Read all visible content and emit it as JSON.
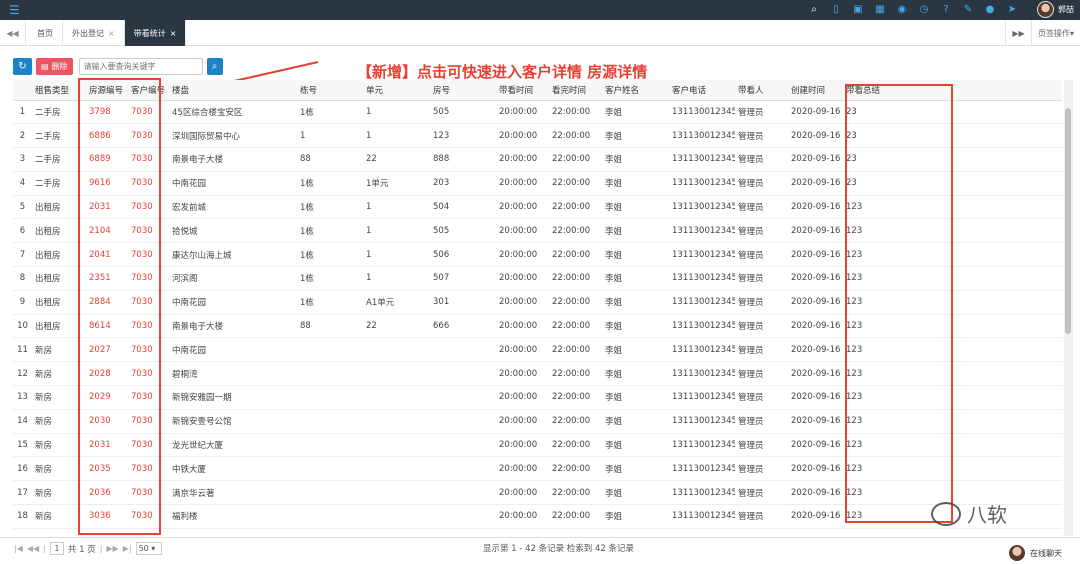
{
  "header": {
    "menu_icon": "menu-icon",
    "icons": [
      "search-icon",
      "phone-icon",
      "ad-icon",
      "grid-icon",
      "location-icon",
      "clock-icon",
      "help-icon",
      "edit-icon",
      "user-icon",
      "run-icon"
    ],
    "user_name": "郭喆"
  },
  "tabs": {
    "items": [
      {
        "label": "首页",
        "active": false
      },
      {
        "label": "外出登记",
        "active": false,
        "close": "×"
      },
      {
        "label": "带看统计",
        "active": true,
        "close": "×"
      }
    ],
    "page_ops": "页签操作",
    "page_ops_arrow": "▾",
    "nav_left": "◀◀",
    "nav_right": "▶▶"
  },
  "toolbar": {
    "delete_label": "删除",
    "search_placeholder": "请输入要查询关键字"
  },
  "annotation": "【新增】点击可快速进入客户详情 房源详情",
  "table": {
    "columns": [
      "",
      "租售类型",
      "房源编号",
      "客户编号",
      "楼盘",
      "栋号",
      "单元",
      "房号",
      "带看时间",
      "看完时间",
      "客户姓名",
      "客户电话",
      "带看人",
      "创建时间",
      "带看总结"
    ],
    "rows": [
      [
        "1",
        "二手房",
        "3798",
        "7030",
        "45区综合楼宝安区",
        "1栋",
        "1",
        "505",
        "20:00:00",
        "22:00:00",
        "李姐",
        "131130012345(",
        "管理员",
        "2020-09-16",
        "23"
      ],
      [
        "2",
        "二手房",
        "6886",
        "7030",
        "深圳国际贸易中心",
        "1",
        "1",
        "123",
        "20:00:00",
        "22:00:00",
        "李姐",
        "131130012345(",
        "管理员",
        "2020-09-16",
        "23"
      ],
      [
        "3",
        "二手房",
        "6889",
        "7030",
        "南景电子大楼",
        "88",
        "22",
        "888",
        "20:00:00",
        "22:00:00",
        "李姐",
        "131130012345(",
        "管理员",
        "2020-09-16",
        "23"
      ],
      [
        "4",
        "二手房",
        "9616",
        "7030",
        "中南花园",
        "1栋",
        "1单元",
        "203",
        "20:00:00",
        "22:00:00",
        "李姐",
        "131130012345(",
        "管理员",
        "2020-09-16",
        "23"
      ],
      [
        "5",
        "出租房",
        "2031",
        "7030",
        "宏发前城",
        "1栋",
        "1",
        "504",
        "20:00:00",
        "22:00:00",
        "李姐",
        "131130012345(",
        "管理员",
        "2020-09-16",
        "123"
      ],
      [
        "6",
        "出租房",
        "2104",
        "7030",
        "拾悦城",
        "1栋",
        "1",
        "505",
        "20:00:00",
        "22:00:00",
        "李姐",
        "131130012345(",
        "管理员",
        "2020-09-16",
        "123"
      ],
      [
        "7",
        "出租房",
        "2041",
        "7030",
        "康达尔山海上城",
        "1栋",
        "1",
        "506",
        "20:00:00",
        "22:00:00",
        "李姐",
        "131130012345(",
        "管理员",
        "2020-09-16",
        "123"
      ],
      [
        "8",
        "出租房",
        "2351",
        "7030",
        "河滨阁",
        "1栋",
        "1",
        "507",
        "20:00:00",
        "22:00:00",
        "李姐",
        "131130012345(",
        "管理员",
        "2020-09-16",
        "123"
      ],
      [
        "9",
        "出租房",
        "2884",
        "7030",
        "中南花园",
        "1栋",
        "A1单元",
        "301",
        "20:00:00",
        "22:00:00",
        "李姐",
        "131130012345(",
        "管理员",
        "2020-09-16",
        "123"
      ],
      [
        "10",
        "出租房",
        "8614",
        "7030",
        "南景电子大楼",
        "88",
        "22",
        "666",
        "20:00:00",
        "22:00:00",
        "李姐",
        "131130012345(",
        "管理员",
        "2020-09-16",
        "123"
      ],
      [
        "11",
        "新房",
        "2027",
        "7030",
        "中南花园",
        "",
        "",
        "",
        "20:00:00",
        "22:00:00",
        "李姐",
        "131130012345(",
        "管理员",
        "2020-09-16",
        "123"
      ],
      [
        "12",
        "新房",
        "2028",
        "7030",
        "碧桐湾",
        "",
        "",
        "",
        "20:00:00",
        "22:00:00",
        "李姐",
        "131130012345(",
        "管理员",
        "2020-09-16",
        "123"
      ],
      [
        "13",
        "新房",
        "2029",
        "7030",
        "新锦安雅园一期",
        "",
        "",
        "",
        "20:00:00",
        "22:00:00",
        "李姐",
        "131130012345(",
        "管理员",
        "2020-09-16",
        "123"
      ],
      [
        "14",
        "新房",
        "2030",
        "7030",
        "新锦安壹号公馆",
        "",
        "",
        "",
        "20:00:00",
        "22:00:00",
        "李姐",
        "131130012345(",
        "管理员",
        "2020-09-16",
        "123"
      ],
      [
        "15",
        "新房",
        "2031",
        "7030",
        "龙光世纪大厦",
        "",
        "",
        "",
        "20:00:00",
        "22:00:00",
        "李姐",
        "131130012345(",
        "管理员",
        "2020-09-16",
        "123"
      ],
      [
        "16",
        "新房",
        "2035",
        "7030",
        "中铁大厦",
        "",
        "",
        "",
        "20:00:00",
        "22:00:00",
        "李姐",
        "131130012345(",
        "管理员",
        "2020-09-16",
        "123"
      ],
      [
        "17",
        "新房",
        "2036",
        "7030",
        "满京华云著",
        "",
        "",
        "",
        "20:00:00",
        "22:00:00",
        "李姐",
        "131130012345(",
        "管理员",
        "2020-09-16",
        "123"
      ],
      [
        "18",
        "新房",
        "3036",
        "7030",
        "福利楼",
        "",
        "",
        "",
        "20:00:00",
        "22:00:00",
        "李姐",
        "131130012345(",
        "管理员",
        "2020-09-16",
        "123"
      ]
    ]
  },
  "pager": {
    "current_page": "1",
    "total_pages": "共 1 页",
    "page_size": "50",
    "summary": "显示第 1 - 42 条记录   检索到 42 条记录"
  },
  "watermark": "八软",
  "chat_label": "在线聊天"
}
